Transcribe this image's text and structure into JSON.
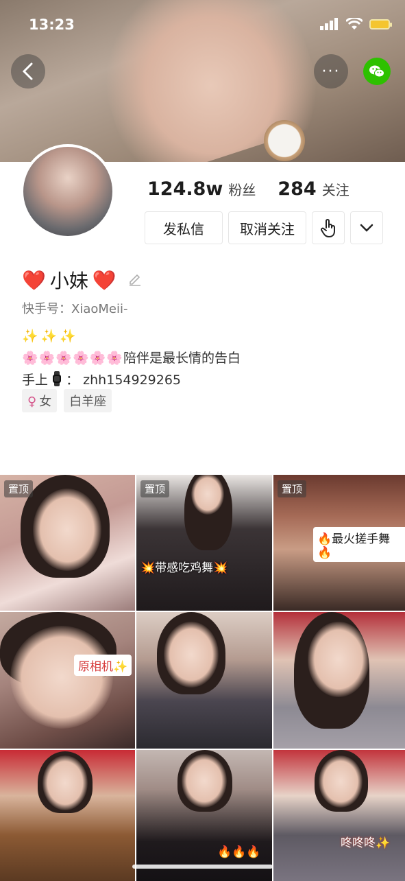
{
  "status_bar": {
    "time": "13:23"
  },
  "header": {
    "back_icon": "back-arrow-icon",
    "more_icon": "more-dots-icon",
    "more_glyph": "···",
    "share_icon": "wechat-icon",
    "colors": {
      "wechat": "#2dc100"
    }
  },
  "profile": {
    "followers_count": "124.8w",
    "followers_label": "粉丝",
    "following_count": "284",
    "following_label": "关注",
    "message_button": "发私信",
    "unfollow_button": "取消关注",
    "name": "小妹",
    "name_decoration": "❤️",
    "kuaishou_id_label": "快手号：",
    "kuaishou_id": "XiaoMeii-",
    "bio_line1": "✨✨✨",
    "bio_line2_emoji": "🌸🌸🌸🌸🌸🌸",
    "bio_line2_text": "陪伴是最长情的告白",
    "bio_line3_prefix": "手上",
    "bio_line3_value": "zhh154929265",
    "tags": [
      {
        "symbol": "♀",
        "label": "女"
      },
      {
        "label": "白羊座"
      }
    ]
  },
  "grid": {
    "pinned_label": "置顶",
    "captions": {
      "c2": "💥带感吃鸡舞💥",
      "c3": "🔥最火搓手舞🔥",
      "c4": "原相机✨",
      "c8": "🔥🔥🔥",
      "c9": "咚咚咚✨"
    }
  }
}
